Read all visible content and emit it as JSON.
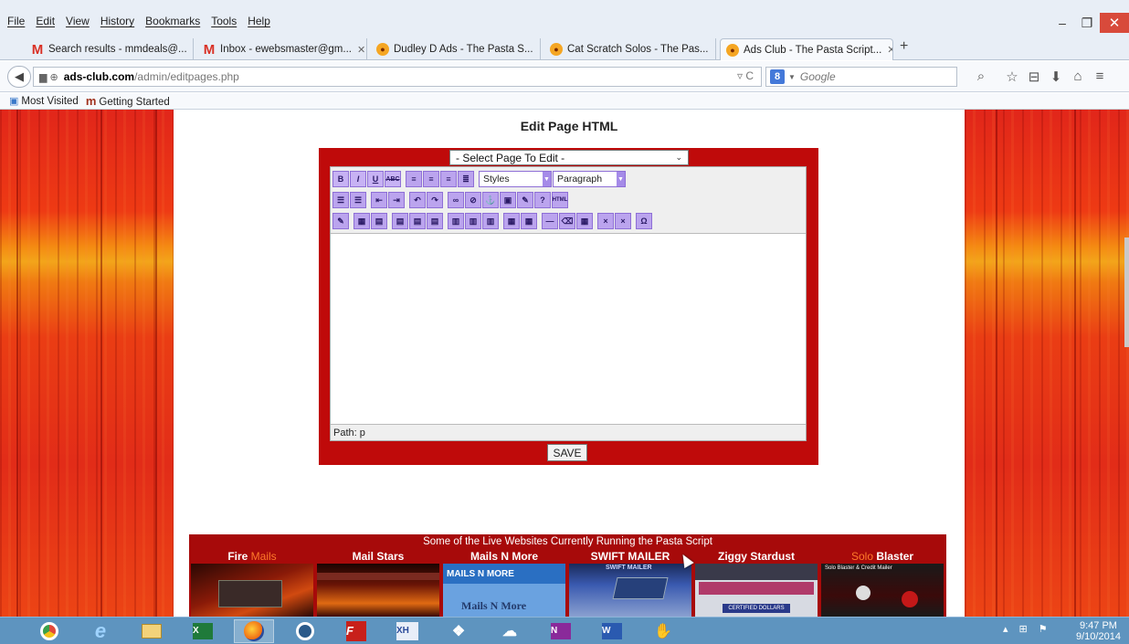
{
  "menu": [
    "File",
    "Edit",
    "View",
    "History",
    "Bookmarks",
    "Tools",
    "Help"
  ],
  "window": {
    "min": "–",
    "max": "❐",
    "close": "✕"
  },
  "tabs": [
    {
      "label": "Search results - mmdeals@...",
      "icon": "gmail-icon"
    },
    {
      "label": "Inbox - ewebsmaster@gm...",
      "icon": "gmail-icon"
    },
    {
      "label": "Dudley D Ads - The Pasta S...",
      "icon": "pasta-icon"
    },
    {
      "label": "Cat Scratch Solos - The Pas...",
      "icon": "pasta-icon"
    },
    {
      "label": "Ads Club - The Pasta Script...",
      "icon": "pasta-icon",
      "active": true
    }
  ],
  "url": {
    "host": "ads-club.com",
    "path": "/admin/editpages.php"
  },
  "search": {
    "placeholder": "Google",
    "engine": "8"
  },
  "bookmarks": [
    "Most Visited",
    "Getting Started"
  ],
  "page": {
    "title": "Edit Page HTML",
    "select_label": "- Select Page To Edit -",
    "styles_label": "Styles",
    "format_label": "Paragraph",
    "path_label": "Path: p",
    "save_label": "SAVE"
  },
  "showcase": {
    "title": "Some of the Live Websites Currently Running the Pasta Script",
    "sites": [
      {
        "pre": "Fire",
        "post": "Mails"
      },
      {
        "name": "Mail Stars"
      },
      {
        "name": "Mails N More"
      },
      {
        "name": "SWIFT MAILER"
      },
      {
        "name": "Ziggy Stardust"
      },
      {
        "pre": "Solo",
        "post": "Blaster"
      }
    ],
    "thumb_texts": {
      "mnm_top": "MAILS N MORE",
      "mnm_logo": "Mails N More",
      "swift": "SWIFT MAILER",
      "ziggy": "CERTIFIED DOLLARS",
      "solo": "Solo Blaster & Credit Mailer"
    }
  },
  "clock": {
    "time": "9:47 PM",
    "date": "9/10/2014"
  },
  "colors": {
    "frame": "#bf0a0a",
    "toolbar_button": "#bba4ee",
    "taskbar": "#5e94bf"
  }
}
